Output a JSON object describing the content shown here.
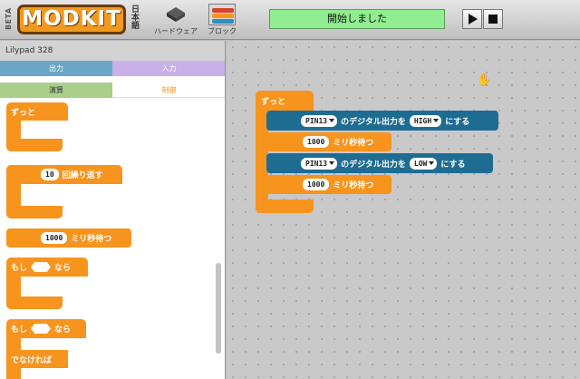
{
  "toolbar": {
    "beta_label": "BETA",
    "logo_text": "MODKIT",
    "language_label": "日本語",
    "hardware_label": "ハードウェア",
    "blocks_label": "ブロック",
    "status_text": "開始しました",
    "play_icon": "play-icon",
    "stop_icon": "stop-icon"
  },
  "palette": {
    "board_name": "Lilypad 328",
    "categories": [
      {
        "label": "出力",
        "color": "#6aa7c6"
      },
      {
        "label": "入力",
        "color": "#c7b1e6"
      },
      {
        "label": "演算",
        "color": "#a9cf8b"
      },
      {
        "label": "制御",
        "color": "#f3941c"
      }
    ],
    "blocks": {
      "forever_label": "ずっと",
      "repeat_count": "10",
      "repeat_label": "回繰り返す",
      "wait_value": "1000",
      "wait_label": "ミリ秒待つ",
      "if_label": "もし",
      "then_label": "なら",
      "if2_label": "もし",
      "then2_label": "なら",
      "else_label": "でなければ"
    }
  },
  "workspace": {
    "forever_label": "ずっと",
    "statements": [
      {
        "pin": "PIN13",
        "middle": "のデジタル出力を",
        "value": "HIGH",
        "suffix": "にする"
      },
      {
        "wait_value": "1000",
        "wait_label": "ミリ秒待つ"
      },
      {
        "pin": "PIN13",
        "middle": "のデジタル出力を",
        "value": "LOW",
        "suffix": "にする"
      },
      {
        "wait_value": "1000",
        "wait_label": "ミリ秒待つ"
      }
    ]
  },
  "colors": {
    "control_orange": "#f7941d",
    "output_blue": "#1f6c93",
    "status_green": "#90ee90"
  }
}
